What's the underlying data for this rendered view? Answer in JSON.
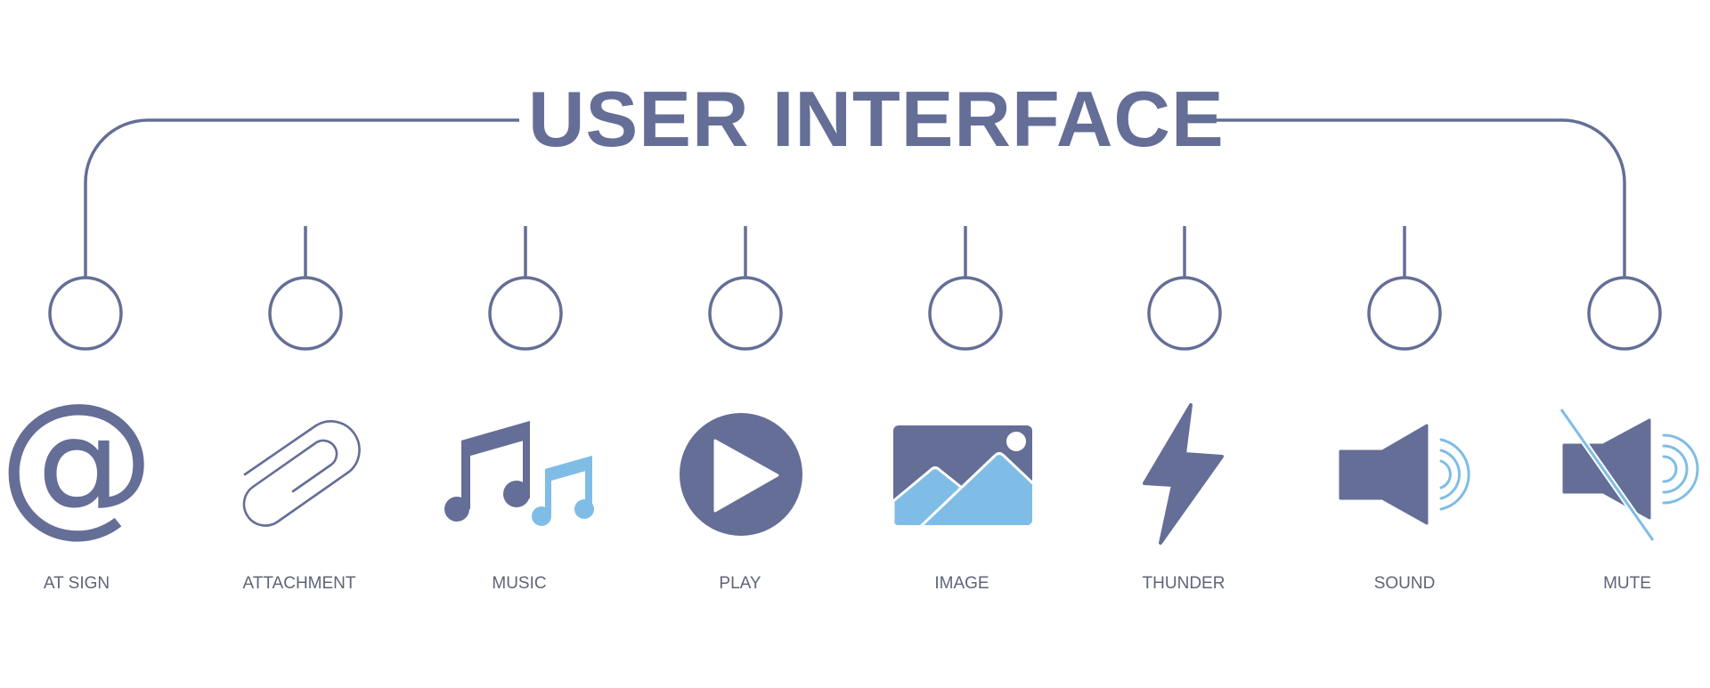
{
  "title": "USER INTERFACE",
  "colors": {
    "primary": "#646e96",
    "accent": "#7fbde6",
    "label": "#5f6478",
    "background": "#ffffff"
  },
  "items": [
    {
      "label": "AT SIGN",
      "icon": "at-sign-icon"
    },
    {
      "label": "ATTACHMENT",
      "icon": "paperclip-icon"
    },
    {
      "label": "MUSIC",
      "icon": "music-notes-icon"
    },
    {
      "label": "PLAY",
      "icon": "play-circle-icon"
    },
    {
      "label": "IMAGE",
      "icon": "image-icon"
    },
    {
      "label": "THUNDER",
      "icon": "lightning-bolt-icon"
    },
    {
      "label": "SOUND",
      "icon": "speaker-sound-icon"
    },
    {
      "label": "MUTE",
      "icon": "speaker-mute-icon"
    }
  ],
  "at_glyph": "@"
}
